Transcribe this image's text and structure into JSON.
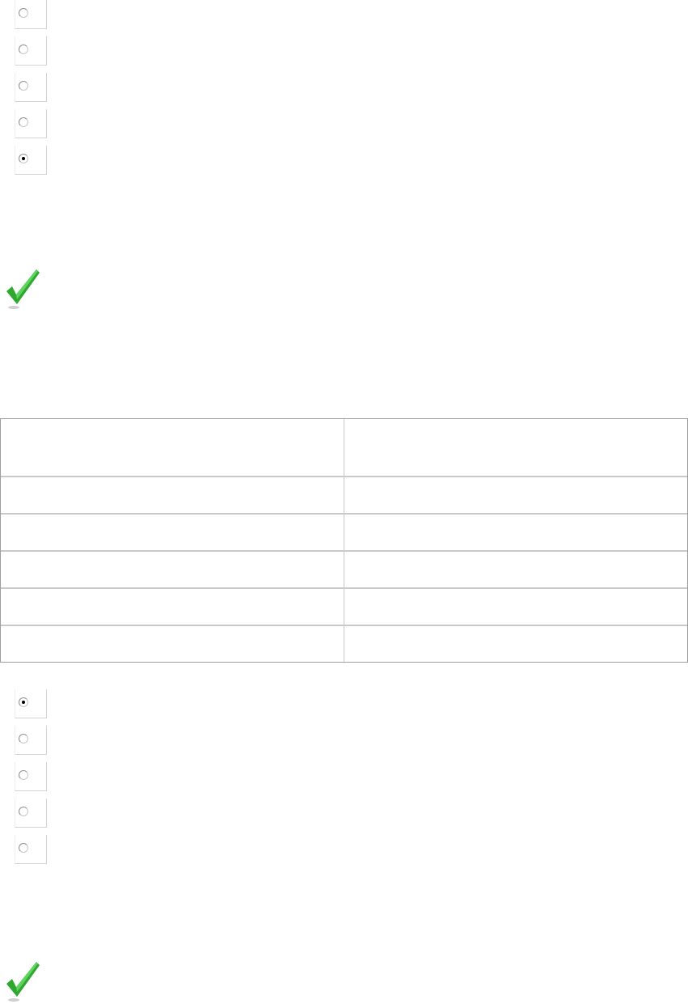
{
  "question_1": {
    "options": [
      {
        "selected": false
      },
      {
        "selected": false
      },
      {
        "selected": false
      },
      {
        "selected": false
      },
      {
        "selected": true
      }
    ],
    "result_icon": "check-mark-icon",
    "result_color": "#2ea82e"
  },
  "answer_table": {
    "header": [
      "",
      ""
    ],
    "rows": [
      [
        "",
        ""
      ],
      [
        "",
        ""
      ],
      [
        "",
        ""
      ],
      [
        "",
        ""
      ],
      [
        "",
        ""
      ]
    ]
  },
  "question_2": {
    "options": [
      {
        "selected": true
      },
      {
        "selected": false
      },
      {
        "selected": false
      },
      {
        "selected": false
      },
      {
        "selected": false
      }
    ],
    "result_icon": "check-mark-icon",
    "result_color": "#2ea82e"
  }
}
